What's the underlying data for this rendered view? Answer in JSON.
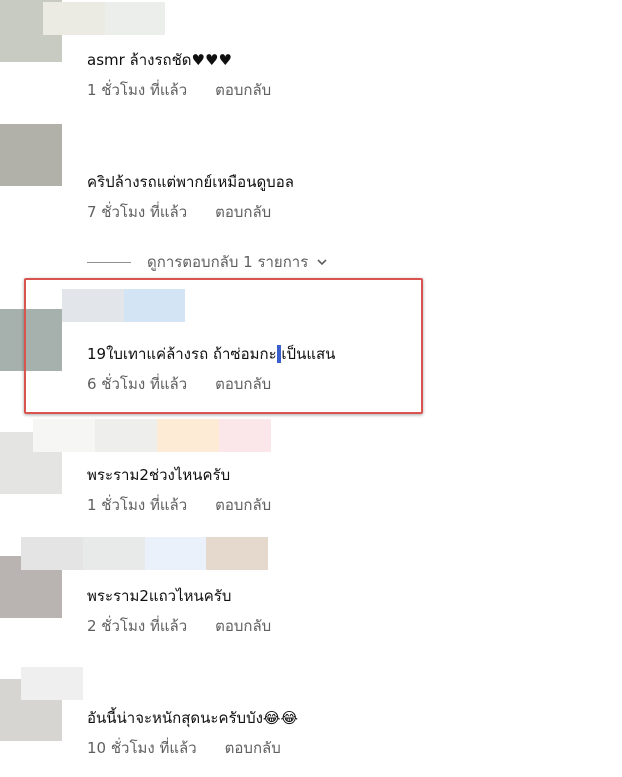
{
  "comments": [
    {
      "text": "asmr ล้างรถชัด♥♥♥",
      "time": "1 ชั่วโมง ที่แล้ว",
      "reply": "ตอบกลับ"
    },
    {
      "text": "คริปล้างรถแต่พากย์เหมือนดูบอล",
      "time": "7 ชั่วโมง ที่แล้ว",
      "reply": "ตอบกลับ"
    },
    {
      "text_before": "19ใบเทาแค่ล้างรถ ถ้าซ่อมกะ",
      "text_after": "เป็นแสน",
      "time": "6 ชั่วโมง ที่แล้ว",
      "reply": "ตอบกลับ"
    },
    {
      "text": "พระราม2ช่วงไหนครับ",
      "time": "1 ชั่วโมง ที่แล้ว",
      "reply": "ตอบกลับ"
    },
    {
      "text": "พระราม2แถวไหนครับ",
      "time": "2 ชั่วโมง ที่แล้ว",
      "reply": "ตอบกลับ"
    },
    {
      "text": "อันนี้น่าจะหนักสุดนะครับบัง😂😂",
      "time": "10 ชั่วโมง ที่แล้ว",
      "reply": "ตอบกลับ"
    }
  ],
  "view_replies": {
    "label": "ดูการตอบกลับ 1 รายการ",
    "icon": "chevron-down-icon"
  },
  "colors": {
    "highlight_border": "#d9534f",
    "text_cursor": "#3a5fcd",
    "meta": "#606060"
  }
}
